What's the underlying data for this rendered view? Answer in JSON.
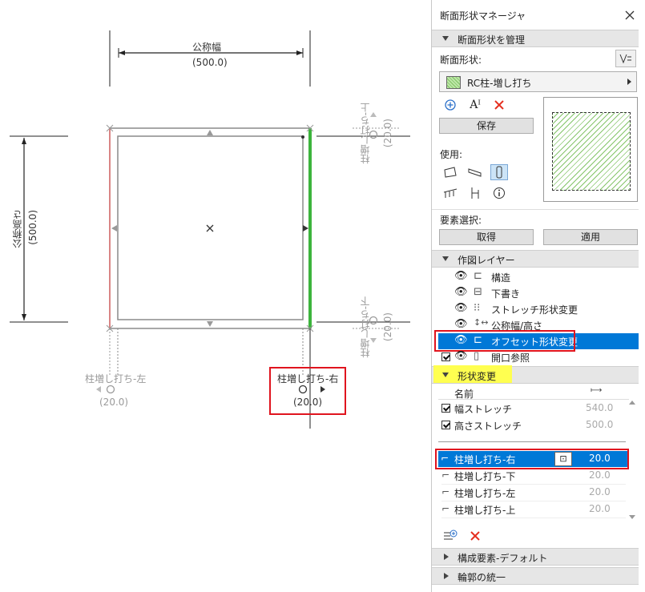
{
  "drawing": {
    "nominal_width_label": "公称幅",
    "nominal_width_value": "(500.0)",
    "nominal_height_label": "公称高さ",
    "nominal_height_value": "(500.0)",
    "offset_top_label": "柱増し打ち-上",
    "offset_top_value": "(20.0)",
    "offset_bottom_label": "柱増し打ち-下",
    "offset_bottom_value": "(20.0)",
    "offset_left_label": "柱増し打ち-左",
    "offset_left_value": "(20.0)",
    "offset_right_label": "柱増し打ち-右",
    "offset_right_value": "(20.0)",
    "colors": {
      "right_edge": "#3cb43c",
      "left_edge": "#e07070",
      "outline": "#808080"
    }
  },
  "panel": {
    "title": "断面形状マネージャ",
    "close_icon": "close-icon",
    "section_manage": "断面形状を管理",
    "profile_label": "断面形状:",
    "profile_name": "RC柱-増し打ち",
    "save_button": "保存",
    "use_label": "使用:",
    "element_select_label": "要素選択:",
    "get_button": "取得",
    "apply_button": "適用",
    "section_layers": "作図レイヤー",
    "layers": [
      {
        "label": "構造",
        "icon": "structure-icon"
      },
      {
        "label": "下書き",
        "icon": "draft-icon"
      },
      {
        "label": "ストレッチ形状変更",
        "icon": "stretch-icon"
      },
      {
        "label": "公称幅/高さ",
        "icon": "nominal-size-icon"
      },
      {
        "label": "オフセット形状変更",
        "icon": "offset-icon",
        "selected": true
      },
      {
        "label": "開口参照",
        "icon": "opening-icon"
      }
    ],
    "section_modifiers": "形状変更",
    "col_name": "名前",
    "stretch_rows": [
      {
        "label": "幅ストレッチ",
        "value": "540.0"
      },
      {
        "label": "高さストレッチ",
        "value": "500.0"
      }
    ],
    "offset_rows": [
      {
        "label": "柱増し打ち-右",
        "value": "20.0",
        "selected": true
      },
      {
        "label": "柱増し打ち-下",
        "value": "20.0"
      },
      {
        "label": "柱増し打ち-左",
        "value": "20.0"
      },
      {
        "label": "柱増し打ち-上",
        "value": "20.0"
      }
    ],
    "section_defaults": "構成要素-デフォルト",
    "section_contour": "輪郭の統一",
    "accent_color": "#0078d7",
    "highlight_color": "#e0141e",
    "yellow_highlight": "#ffff50"
  }
}
